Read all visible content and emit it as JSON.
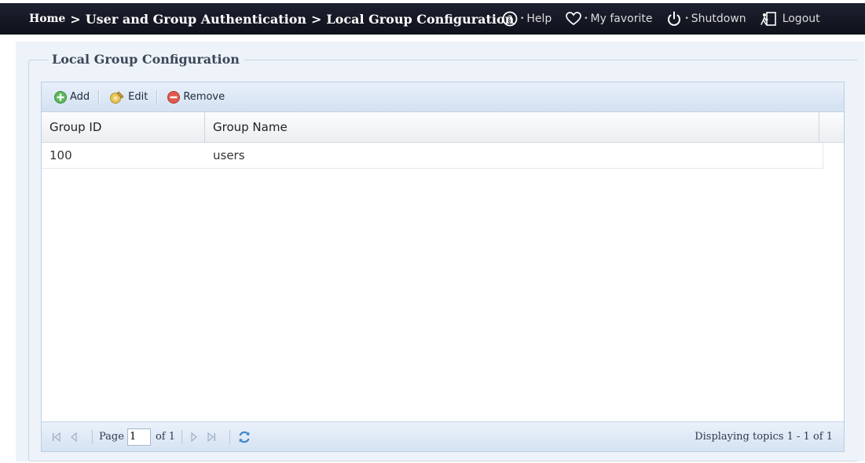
{
  "header": {
    "breadcrumb": {
      "home": "Home",
      "separator": ">",
      "section": "User and Group Authentication",
      "page": "Local Group Configuration"
    },
    "links": {
      "help": "Help",
      "favorite": "My favorite",
      "shutdown": "Shutdown",
      "logout": "Logout"
    }
  },
  "panel": {
    "legend": "Local Group Configuration"
  },
  "toolbar": {
    "add_label": "Add",
    "edit_label": "Edit",
    "remove_label": "Remove"
  },
  "table": {
    "columns": [
      "Group ID",
      "Group Name"
    ],
    "rows": [
      {
        "group_id": "100",
        "group_name": "users"
      }
    ]
  },
  "pager": {
    "page_label": "Page",
    "page_value": "1",
    "of_label": "of 1",
    "display_text": "Displaying topics 1 - 1 of 1"
  },
  "colors": {
    "topbar": "#141824",
    "panel_bg": "#eef3f9",
    "toolbar_bg": "#dbe6f4",
    "add_green": "#5cb85c",
    "remove_red": "#e05a4f",
    "edit_gold": "#d9b343"
  }
}
